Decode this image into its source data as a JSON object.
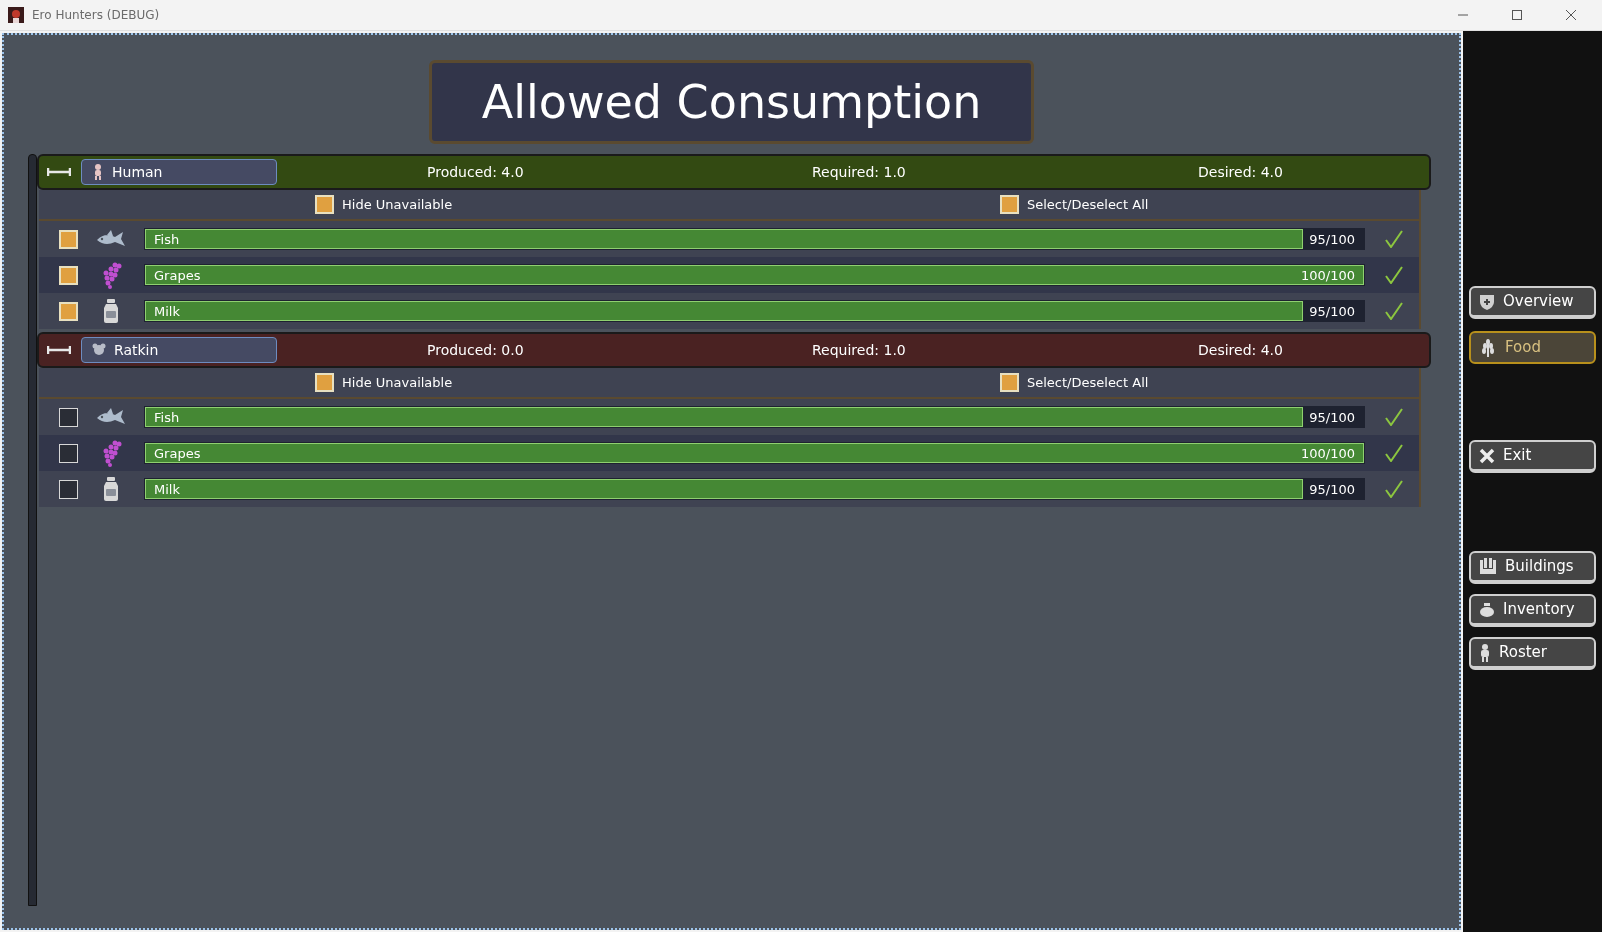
{
  "window": {
    "title": "Ero Hunters (DEBUG)"
  },
  "page_title": "Allowed Consumption",
  "groups": [
    {
      "name": "Human",
      "kind": "human",
      "color": "#334a12",
      "produced": "Produced: 4.0",
      "required": "Required: 1.0",
      "desired": "Desired: 4.0",
      "hide_unavailable": {
        "label": "Hide Unavailable",
        "checked": true
      },
      "select_all": {
        "label": "Select/Deselect All",
        "checked": true
      },
      "items": [
        {
          "name": "Fish",
          "kind": "fish",
          "checked": true,
          "level": 0.95,
          "reading": "95/100"
        },
        {
          "name": "Grapes",
          "kind": "grapes",
          "checked": true,
          "level": 1,
          "reading": "100/100"
        },
        {
          "name": "Milk",
          "kind": "milk",
          "checked": true,
          "level": 0.95,
          "reading": "95/100"
        }
      ]
    },
    {
      "name": "Ratkin",
      "kind": "ratkin",
      "color": "#4a2222",
      "produced": "Produced: 0.0",
      "required": "Required: 1.0",
      "desired": "Desired: 4.0",
      "hide_unavailable": {
        "label": "Hide Unavailable",
        "checked": true
      },
      "select_all": {
        "label": "Select/Deselect All",
        "checked": true
      },
      "items": [
        {
          "name": "Fish",
          "kind": "fish",
          "checked": false,
          "level": 0.95,
          "reading": "95/100"
        },
        {
          "name": "Grapes",
          "kind": "grapes",
          "checked": false,
          "level": 1,
          "reading": "100/100"
        },
        {
          "name": "Milk",
          "kind": "milk",
          "checked": false,
          "level": 0.95,
          "reading": "95/100"
        }
      ]
    }
  ],
  "nav": [
    {
      "label": "Overview",
      "kind": "overview",
      "selected": false
    },
    {
      "label": "Food",
      "kind": "food",
      "selected": true
    },
    {
      "label": "Exit",
      "kind": "exit",
      "selected": false
    },
    {
      "label": "Buildings",
      "kind": "buildings",
      "selected": false
    },
    {
      "label": "Inventory",
      "kind": "inventory",
      "selected": false
    },
    {
      "label": "Roster",
      "kind": "roster",
      "selected": false
    }
  ]
}
